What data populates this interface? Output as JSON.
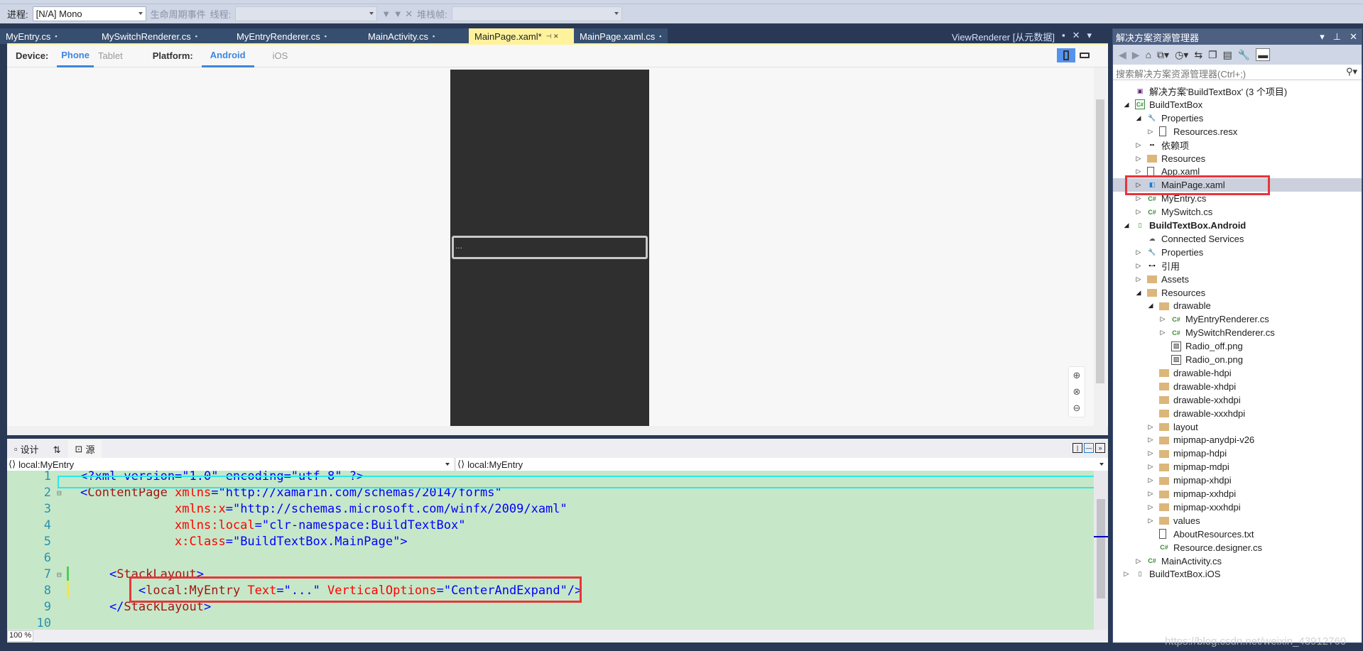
{
  "debug_toolbar": {
    "process_label": "进程:",
    "process_value": "[N/A] Mono",
    "lifecycle_label": "生命周期事件",
    "thread_label": "线程:",
    "stackframe_label": "堆栈帧:"
  },
  "tabs": [
    {
      "label": "MyEntry.cs",
      "active": false
    },
    {
      "label": "MySwitchRenderer.cs",
      "active": false
    },
    {
      "label": "MyEntryRenderer.cs",
      "active": false
    },
    {
      "label": "MainActivity.cs",
      "active": false
    },
    {
      "label": "MainPage.xaml*",
      "active": true
    },
    {
      "label": "MainPage.xaml.cs",
      "active": false
    }
  ],
  "viewrenderer_label": "ViewRenderer [从元数据]",
  "designer": {
    "device_label": "Device:",
    "devices": [
      "Phone",
      "Tablet"
    ],
    "selected_device": "Phone",
    "platform_label": "Platform:",
    "platforms": [
      "Android",
      "iOS"
    ],
    "selected_platform": "Android",
    "entry_text": "..."
  },
  "view_tabs": {
    "design": "设计",
    "swap": "⇅",
    "source": "源"
  },
  "navbar": {
    "left": "local:MyEntry",
    "right": "local:MyEntry"
  },
  "code": [
    {
      "n": "1",
      "seg": [
        [
          "t-pun",
          "<?xml version=\"1.0\" encoding=\"utf-8\" ?>"
        ]
      ]
    },
    {
      "n": "2",
      "seg": [
        [
          "t-pun",
          "<"
        ],
        [
          "t-tag",
          "ContentPage"
        ],
        [
          "t-attr",
          " xmlns"
        ],
        [
          "t-pun",
          "="
        ],
        [
          "t-val",
          "\"http://xamarin.com/schemas/2014/forms\""
        ]
      ]
    },
    {
      "n": "3",
      "seg": [
        [
          "t-attr",
          "             xmlns:x"
        ],
        [
          "t-pun",
          "="
        ],
        [
          "t-val",
          "\"http://schemas.microsoft.com/winfx/2009/xaml\""
        ]
      ]
    },
    {
      "n": "4",
      "seg": [
        [
          "t-attr",
          "             xmlns:local"
        ],
        [
          "t-pun",
          "="
        ],
        [
          "t-val",
          "\"clr-namespace:BuildTextBox\""
        ]
      ]
    },
    {
      "n": "5",
      "seg": [
        [
          "t-attr",
          "             x:Class"
        ],
        [
          "t-pun",
          "="
        ],
        [
          "t-val",
          "\"BuildTextBox.MainPage\""
        ],
        [
          "t-pun",
          ">"
        ]
      ]
    },
    {
      "n": "6",
      "seg": []
    },
    {
      "n": "7",
      "seg": [
        [
          "t-pun",
          "    <"
        ],
        [
          "t-tag",
          "StackLayout"
        ],
        [
          "t-pun",
          ">"
        ]
      ]
    },
    {
      "n": "8",
      "seg": [
        [
          "t-pun",
          "        <"
        ],
        [
          "t-tag",
          "local:MyEntry"
        ],
        [
          "t-attr",
          " Text"
        ],
        [
          "t-pun",
          "="
        ],
        [
          "t-val",
          "\"...\""
        ],
        [
          "t-attr",
          " VerticalOptions"
        ],
        [
          "t-pun",
          "="
        ],
        [
          "t-val",
          "\"CenterAndExpand\""
        ],
        [
          "t-pun",
          "/>"
        ]
      ]
    },
    {
      "n": "9",
      "seg": [
        [
          "t-pun",
          "    </"
        ],
        [
          "t-tag",
          "StackLayout"
        ],
        [
          "t-pun",
          ">"
        ]
      ]
    },
    {
      "n": "10",
      "seg": []
    }
  ],
  "zoom": "100 %",
  "solution_explorer": {
    "title": "解决方案资源管理器",
    "search_placeholder": "搜索解决方案资源管理器(Ctrl+;)",
    "selected_item": "MainPage.xaml",
    "items": [
      {
        "label": "解决方案'BuildTextBox' (3 个项目)",
        "level": 0,
        "tw": "none",
        "icon": "solution"
      },
      {
        "label": "BuildTextBox",
        "level": 0,
        "tw": "open",
        "icon": "csproj"
      },
      {
        "label": "Properties",
        "level": 1,
        "tw": "open",
        "icon": "wrench"
      },
      {
        "label": "Resources.resx",
        "level": 2,
        "tw": "closed",
        "icon": "file"
      },
      {
        "label": "依赖项",
        "level": 1,
        "tw": "closed",
        "icon": "deps"
      },
      {
        "label": "Resources",
        "level": 1,
        "tw": "closed",
        "icon": "folder"
      },
      {
        "label": "App.xaml",
        "level": 1,
        "tw": "closed",
        "icon": "file"
      },
      {
        "label": "MainPage.xaml",
        "level": 1,
        "tw": "closed",
        "icon": "xaml"
      },
      {
        "label": "MyEntry.cs",
        "level": 1,
        "tw": "closed",
        "icon": "cs"
      },
      {
        "label": "MySwitch.cs",
        "level": 1,
        "tw": "closed",
        "icon": "cs"
      },
      {
        "label": "BuildTextBox.Android",
        "level": 0,
        "tw": "open",
        "icon": "android",
        "bold": true
      },
      {
        "label": "Connected Services",
        "level": 1,
        "tw": "none",
        "icon": "cloud"
      },
      {
        "label": "Properties",
        "level": 1,
        "tw": "closed",
        "icon": "wrench"
      },
      {
        "label": "引用",
        "level": 1,
        "tw": "closed",
        "icon": "refs"
      },
      {
        "label": "Assets",
        "level": 1,
        "tw": "closed",
        "icon": "folder"
      },
      {
        "label": "Resources",
        "level": 1,
        "tw": "open",
        "icon": "folder"
      },
      {
        "label": "drawable",
        "level": 2,
        "tw": "open",
        "icon": "folder"
      },
      {
        "label": "MyEntryRenderer.cs",
        "level": 3,
        "tw": "closed",
        "icon": "cs"
      },
      {
        "label": "MySwitchRenderer.cs",
        "level": 3,
        "tw": "closed",
        "icon": "cs"
      },
      {
        "label": "Radio_off.png",
        "level": 3,
        "tw": "none",
        "icon": "image"
      },
      {
        "label": "Radio_on.png",
        "level": 3,
        "tw": "none",
        "icon": "image"
      },
      {
        "label": "drawable-hdpi",
        "level": 2,
        "tw": "none",
        "icon": "folder"
      },
      {
        "label": "drawable-xhdpi",
        "level": 2,
        "tw": "none",
        "icon": "folder"
      },
      {
        "label": "drawable-xxhdpi",
        "level": 2,
        "tw": "none",
        "icon": "folder"
      },
      {
        "label": "drawable-xxxhdpi",
        "level": 2,
        "tw": "none",
        "icon": "folder"
      },
      {
        "label": "layout",
        "level": 2,
        "tw": "closed",
        "icon": "folder"
      },
      {
        "label": "mipmap-anydpi-v26",
        "level": 2,
        "tw": "closed",
        "icon": "folder"
      },
      {
        "label": "mipmap-hdpi",
        "level": 2,
        "tw": "closed",
        "icon": "folder"
      },
      {
        "label": "mipmap-mdpi",
        "level": 2,
        "tw": "closed",
        "icon": "folder"
      },
      {
        "label": "mipmap-xhdpi",
        "level": 2,
        "tw": "closed",
        "icon": "folder"
      },
      {
        "label": "mipmap-xxhdpi",
        "level": 2,
        "tw": "closed",
        "icon": "folder"
      },
      {
        "label": "mipmap-xxxhdpi",
        "level": 2,
        "tw": "closed",
        "icon": "folder"
      },
      {
        "label": "values",
        "level": 2,
        "tw": "closed",
        "icon": "folder"
      },
      {
        "label": "AboutResources.txt",
        "level": 2,
        "tw": "none",
        "icon": "file"
      },
      {
        "label": "Resource.designer.cs",
        "level": 2,
        "tw": "none",
        "icon": "cs"
      },
      {
        "label": "MainActivity.cs",
        "level": 1,
        "tw": "closed",
        "icon": "cs"
      },
      {
        "label": "BuildTextBox.iOS",
        "level": 0,
        "tw": "closed",
        "icon": "ios"
      }
    ]
  },
  "watermark": "https://blog.csdn.net/weixin_43912760",
  "colors": {
    "highlight_box": "#e8353b",
    "active_tab": "#fff29d",
    "accent": "#3d86e0",
    "editor_bg": "#c6e8c8"
  }
}
